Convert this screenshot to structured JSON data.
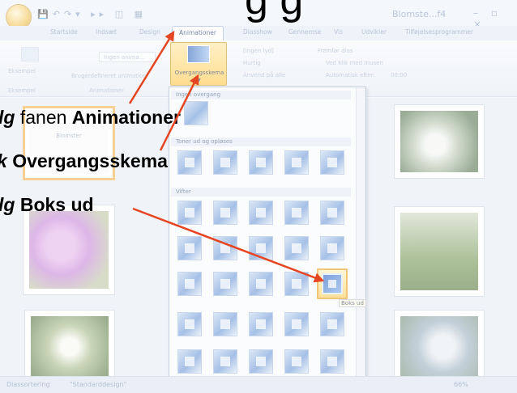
{
  "title_fragment": "g                   g",
  "qat": {
    "title": "Blomste...f4",
    "controls": "– ▫ ×"
  },
  "tabs": [
    {
      "label": "Startside"
    },
    {
      "label": "Indsæt"
    },
    {
      "label": "Design"
    },
    {
      "label": "Animationer",
      "active": true
    },
    {
      "label": "Diasshow"
    },
    {
      "label": "Gennemse"
    },
    {
      "label": "Vis"
    },
    {
      "label": "Udvikler"
    },
    {
      "label": "Tilføjelsesprogrammer"
    }
  ],
  "ribbon": {
    "preview_label": "Eksempel",
    "preview_group": "Eksempel",
    "animate_value": "Ingen anima...",
    "custom_animation": "Brugerdefineret animation",
    "animations_group": "Animationer",
    "transition_button": "Overgangsskema",
    "sound_value": "[Ingen lyd]",
    "speed_value": "Hurtig",
    "apply_all": "Anvend på alle",
    "advance_label": "Fremfør dias",
    "on_click": "Ved klik med musen",
    "auto_after": "Automatisk efter:",
    "auto_time": "00:00"
  },
  "gallery": {
    "section_none": "Ingen overgang",
    "section_fades": "Toner ud og opløses",
    "section_wipes": "Vifter",
    "hover_tooltip": "Boks ud"
  },
  "slide_label": "Blomster",
  "status": {
    "view": "Diassortering",
    "theme": "\"Standarddesign\"",
    "zoom": "66%"
  },
  "instructions": {
    "step1_verb": "lg",
    "step1_text": " fanen ",
    "step1_target": "Animationer",
    "step2_verb": "k",
    "step2_target": "Overgangsskema",
    "step3_verb": "lg",
    "step3_target": "Boks ud"
  },
  "colors": {
    "arrow": "#e64522",
    "highlight": "#f5b453"
  }
}
